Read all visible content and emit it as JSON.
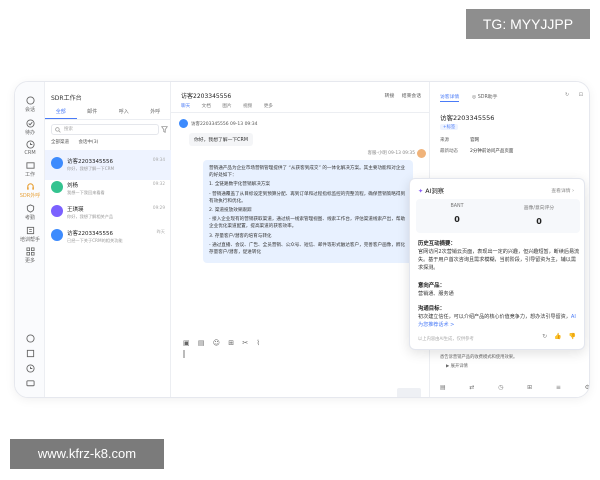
{
  "watermark_top": "TG: MYYJJPP",
  "watermark_bottom": "www.kfrz-k8.com",
  "rail": {
    "items": [
      {
        "label": "会话",
        "icon": "chat-icon"
      },
      {
        "label": "待办",
        "icon": "check-circle-icon"
      },
      {
        "label": "CRM",
        "icon": "clock-icon"
      },
      {
        "label": "工作",
        "icon": "folder-icon"
      },
      {
        "label": "SDR外呼",
        "icon": "headset-icon"
      },
      {
        "label": "考勤",
        "icon": "shield-icon"
      },
      {
        "label": "培训帮手",
        "icon": "book-icon"
      },
      {
        "label": "更多",
        "icon": "grid-icon"
      }
    ]
  },
  "list": {
    "title": "SDR工作台",
    "tabs": [
      "全部",
      "邮件",
      "呼入",
      "外呼"
    ],
    "active_tab": 0,
    "search_placeholder": "搜索",
    "filter_a": "全部渠道",
    "filter_b": "会话中(3)",
    "conversations": [
      {
        "name": "访客2203345556",
        "preview": "你好，我想了解一下CRM",
        "time": "09:34",
        "color": "#3d8bfd"
      },
      {
        "name": "刘杨",
        "preview": "我想一下我回来看看",
        "time": "09:32",
        "color": "#34c38f"
      },
      {
        "name": "王琪瑛",
        "preview": "你好，我想了解相关产品",
        "time": "09:29",
        "color": "#7b61ff"
      },
      {
        "name": "访客2203345556",
        "preview": "已经一下关于CRM的相关功能",
        "time": "昨天",
        "color": "#3d8bfd"
      }
    ]
  },
  "chat": {
    "title": "访客2203345556",
    "action_transfer": "转接",
    "action_end": "结束会话",
    "tabs": [
      "聊天",
      "文档",
      "图片",
      "视频",
      "更多"
    ],
    "customer_line": "访客2203345556 09-13 09:34",
    "customer_message": "你好，我想了解一下CRM",
    "agent_line": "客服-小明 09-13 09:35",
    "agent_paragraphs": [
      "营销通产品为企业市场营销管理提供了 “从获客到成交” 的一体化解决方案。其主要功能和对企业的好处如下：",
      "1. 全链路数字化营销解决方案",
      "- 营销通覆盖了从目标设定到预算分配、再到订单和过程指标监控的完整流程，确保营销策略得到有效执行和优化。",
      "2. 渠道投放效果跟踪",
      "- 接入企业现有的营销获取渠道，通过统一线索管理视图、线索工作台，评估渠道线索产出，帮助企业优化渠道配置，提高渠道的获客效率。",
      "3. 存量客户/潜客的培育与转化",
      "- 通过直播、会议、广告、全员营销、公众号、短信、邮件等形式触达客户，完善客户画像，孵化存量客户/潜客，促进转化"
    ]
  },
  "right": {
    "tabs": [
      "访客详情",
      "SDR助手"
    ],
    "active_tab": 0,
    "visitor_name": "访客2203345556",
    "tag": "+标签",
    "rows": [
      {
        "k": "来源",
        "v": "官网"
      },
      {
        "k": "最新动态",
        "v": "2分钟前访问产品页面"
      }
    ],
    "bottom_text": "悉告诉营销产品的收费模式和使用效果。",
    "bottom_link": "▶ 展开详情"
  },
  "ai": {
    "title": "AI洞察",
    "more": "查看详情",
    "metric1_label": "BANT",
    "metric1_value": "0",
    "metric2_label": "画像/意向评分",
    "metric2_value": "0",
    "sec1": "历史互动摘要：",
    "txt1": "官网访问2次营销云页面，表现出一定的兴趣，但兴趣短暂，断续后易流失。基于用户首次咨询且需求模糊，当前阶段，引导留资为主，辅以需求探测。",
    "sec2": "意向产品：",
    "txt2": "营销通、服务通",
    "sec3": "沟通目标：",
    "txt3": "初次建立信任，可以介绍产品的核心价值竞争力，想办法引导留资，",
    "txt3_link": "AI为您推荐话术 >",
    "foot": "以上内容由AI生成，仅供参考"
  }
}
